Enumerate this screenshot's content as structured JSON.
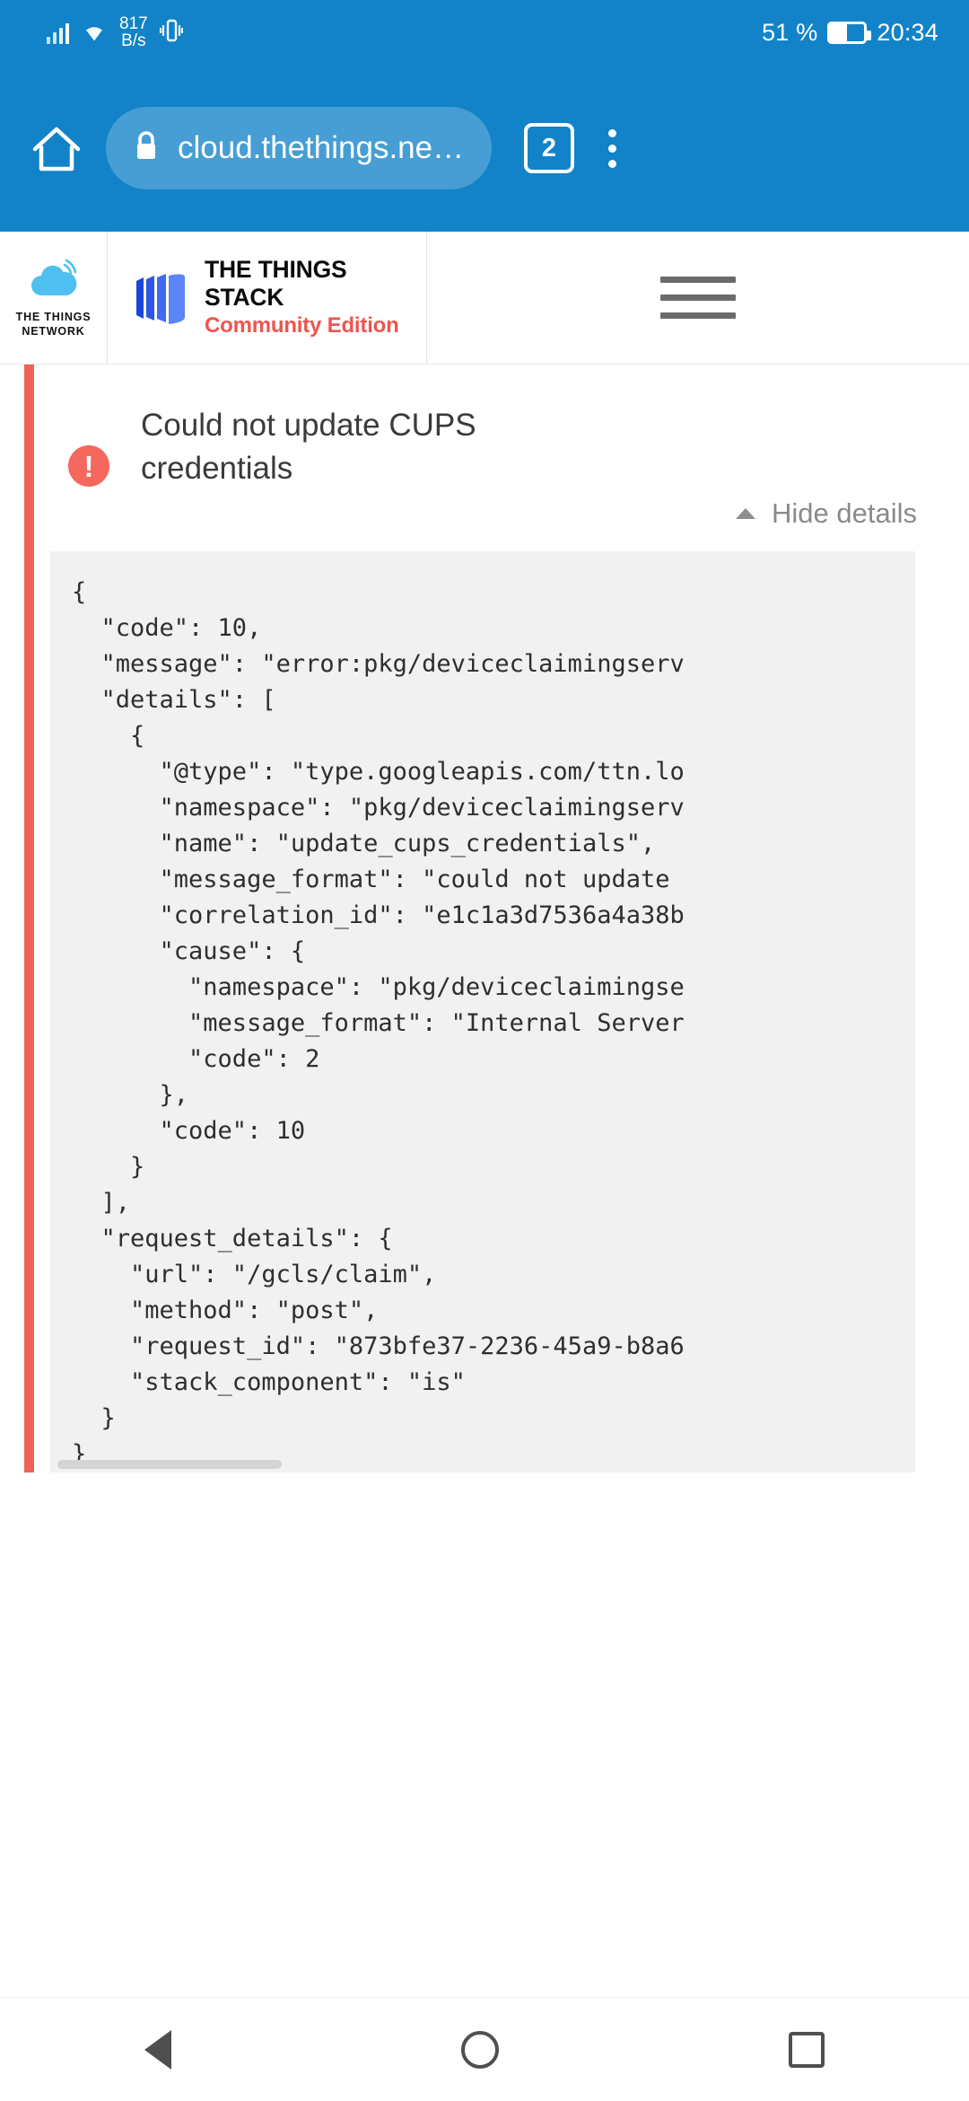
{
  "status_bar": {
    "data_rate_value": "817",
    "data_rate_unit": "B/s",
    "battery_percent": "51 %",
    "clock": "20:34",
    "signal_icon": "signal-bars-icon",
    "wifi_icon": "wifi-icon",
    "vibrate_icon": "vibrate-icon",
    "battery_icon": "battery-icon"
  },
  "browser": {
    "home_icon": "home-icon",
    "lock_icon": "lock-icon",
    "url": "cloud.thethings.network",
    "tab_count": "2",
    "menu_icon": "overflow-menu-icon"
  },
  "site_header": {
    "ttn_logo_icon": "the-things-network-cloud-logo",
    "ttn_logo_line1": "THE THINGS",
    "ttn_logo_line2": "NETWORK",
    "stack_logo_icon": "the-things-stack-logo",
    "stack_title": "THE THINGS STACK",
    "stack_subtitle": "Community Edition",
    "stack_subtitle_color": "#f0544f",
    "menu_icon": "hamburger-menu-icon"
  },
  "error": {
    "icon": "error-exclamation-icon",
    "accent_color": "#ef6257",
    "title": "Could not update CUPS credentials",
    "toggle_icon": "chevron-up-icon",
    "toggle_label": "Hide details",
    "details_json": "{\n  \"code\": 10,\n  \"message\": \"error:pkg/deviceclaimingserv\n  \"details\": [\n    {\n      \"@type\": \"type.googleapis.com/ttn.lo\n      \"namespace\": \"pkg/deviceclaimingserv\n      \"name\": \"update_cups_credentials\",\n      \"message_format\": \"could not update \n      \"correlation_id\": \"e1c1a3d7536a4a38b\n      \"cause\": {\n        \"namespace\": \"pkg/deviceclaimingse\n        \"message_format\": \"Internal Server\n        \"code\": 2\n      },\n      \"code\": 10\n    }\n  ],\n  \"request_details\": {\n    \"url\": \"/gcls/claim\",\n    \"method\": \"post\",\n    \"request_id\": \"873bfe37-2236-45a9-b8a6\n    \"stack_component\": \"is\"\n  }\n}",
    "scrollbar": "horizontal-scrollbar"
  },
  "nav_bar": {
    "back_icon": "back-triangle-icon",
    "home_icon": "home-circle-icon",
    "recents_icon": "recents-square-icon"
  }
}
